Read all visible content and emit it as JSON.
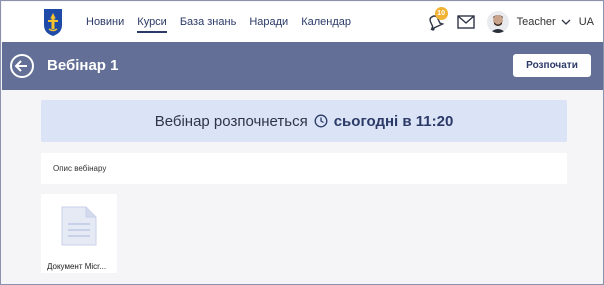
{
  "nav": {
    "items": [
      {
        "label": "Новини",
        "active": false
      },
      {
        "label": "Курси",
        "active": true
      },
      {
        "label": "База знань",
        "active": false
      },
      {
        "label": "Наради",
        "active": false
      },
      {
        "label": "Календар",
        "active": false
      }
    ]
  },
  "user": {
    "notifications_count": "10",
    "name": "Teacher",
    "language": "UA"
  },
  "header": {
    "title": "Вебінар 1",
    "start_label": "Розпочати"
  },
  "banner": {
    "text": "Вебінар розпочнеться",
    "time": "сьогодні в 11:20"
  },
  "description": {
    "label": "Опис вебінару"
  },
  "document": {
    "name": "Документ Micr..."
  },
  "colors": {
    "header": "#636f96",
    "banner": "#dbe3f6",
    "accent": "#2b3a67",
    "badge": "#f2b233"
  },
  "icons": [
    "kyiv-coat-of-arms-logo",
    "bell-icon",
    "mail-icon",
    "avatar",
    "chevron-down-icon",
    "back-arrow-icon",
    "clock-icon",
    "document-icon"
  ]
}
